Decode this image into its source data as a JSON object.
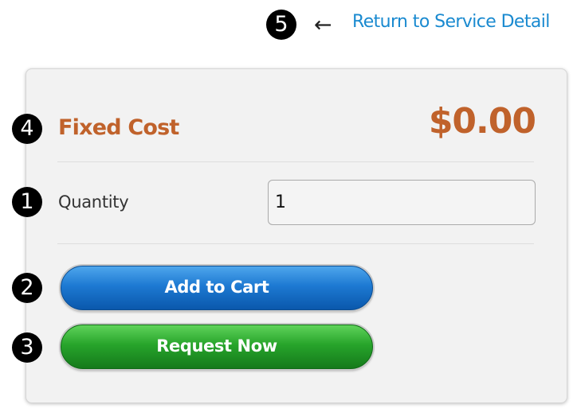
{
  "markers": {
    "m1": "1",
    "m2": "2",
    "m3": "3",
    "m4": "4",
    "m5": "5"
  },
  "header": {
    "arrow_icon": "left-arrow-icon",
    "return_link": "Return to Service Detail"
  },
  "pricing": {
    "label": "Fixed Cost",
    "amount": "$0.00"
  },
  "quantity": {
    "label": "Quantity",
    "value": "1"
  },
  "actions": {
    "add_to_cart": "Add to Cart",
    "request_now": "Request Now"
  },
  "colors": {
    "accent_orange": "#c0622b",
    "link_blue": "#1a8ad0",
    "cart_blue": "#1d79d2",
    "request_green": "#27a42b"
  }
}
